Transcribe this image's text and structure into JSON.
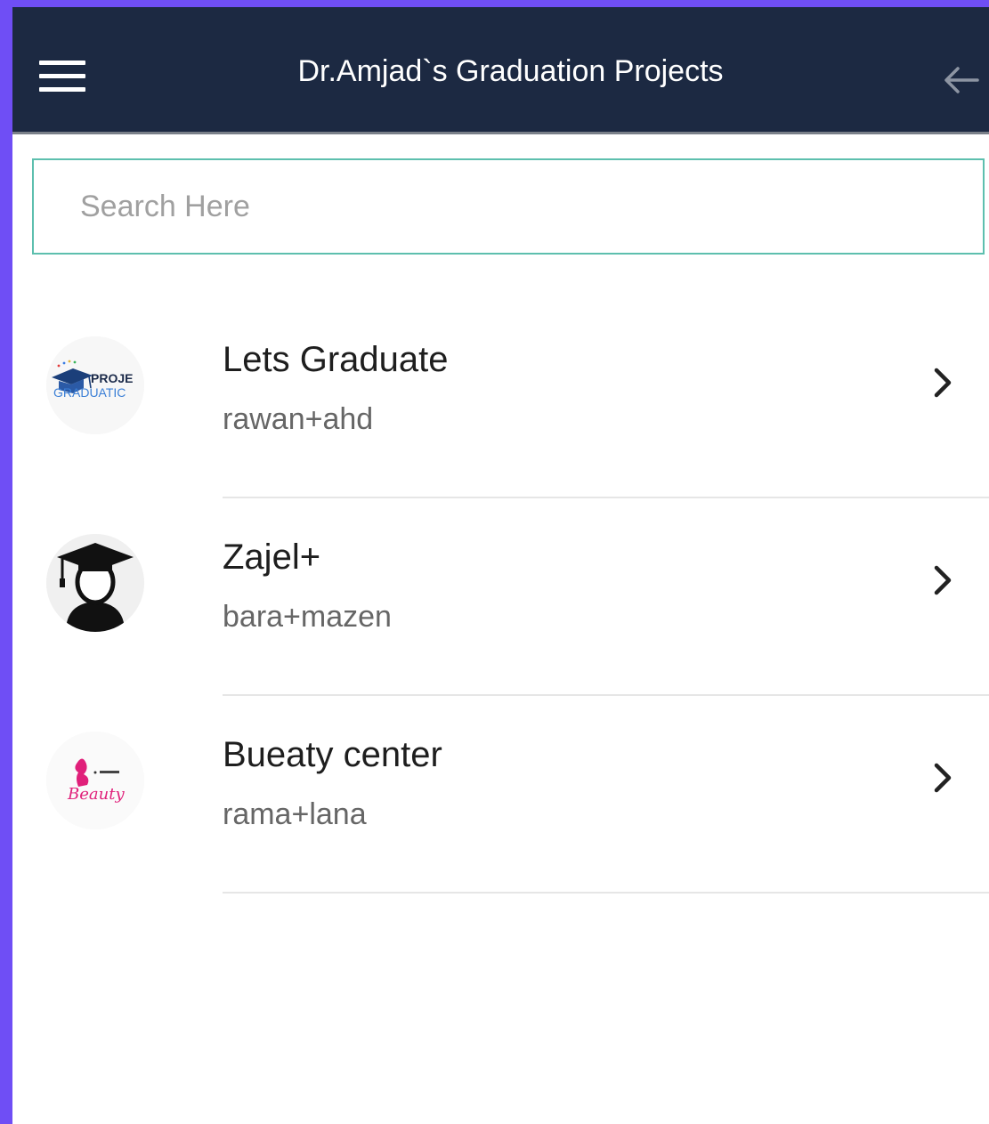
{
  "appbar": {
    "title": "Dr.Amjad`s Graduation Projects",
    "menu_icon": "hamburger-menu-icon",
    "back_icon": "arrow-left-icon",
    "background": "#1c2942"
  },
  "search": {
    "placeholder": "Search Here",
    "value": "",
    "border_color": "#5dbfae"
  },
  "projects": [
    {
      "title": "Lets Graduate",
      "members": "rawan+ahd",
      "avatar_icon": "project-graduation-logo-icon",
      "logo_text_top": "PROJE",
      "logo_text_bottom": "GRADUATIC"
    },
    {
      "title": "Zajel+",
      "members": "bara+mazen",
      "avatar_icon": "graduate-person-icon"
    },
    {
      "title": "Bueaty center",
      "members": "rama+lana",
      "avatar_icon": "beauty-logo-icon",
      "logo_text": "Beauty"
    }
  ],
  "colors": {
    "frame": "#6f4ef5",
    "accent": "#5dbfae"
  }
}
